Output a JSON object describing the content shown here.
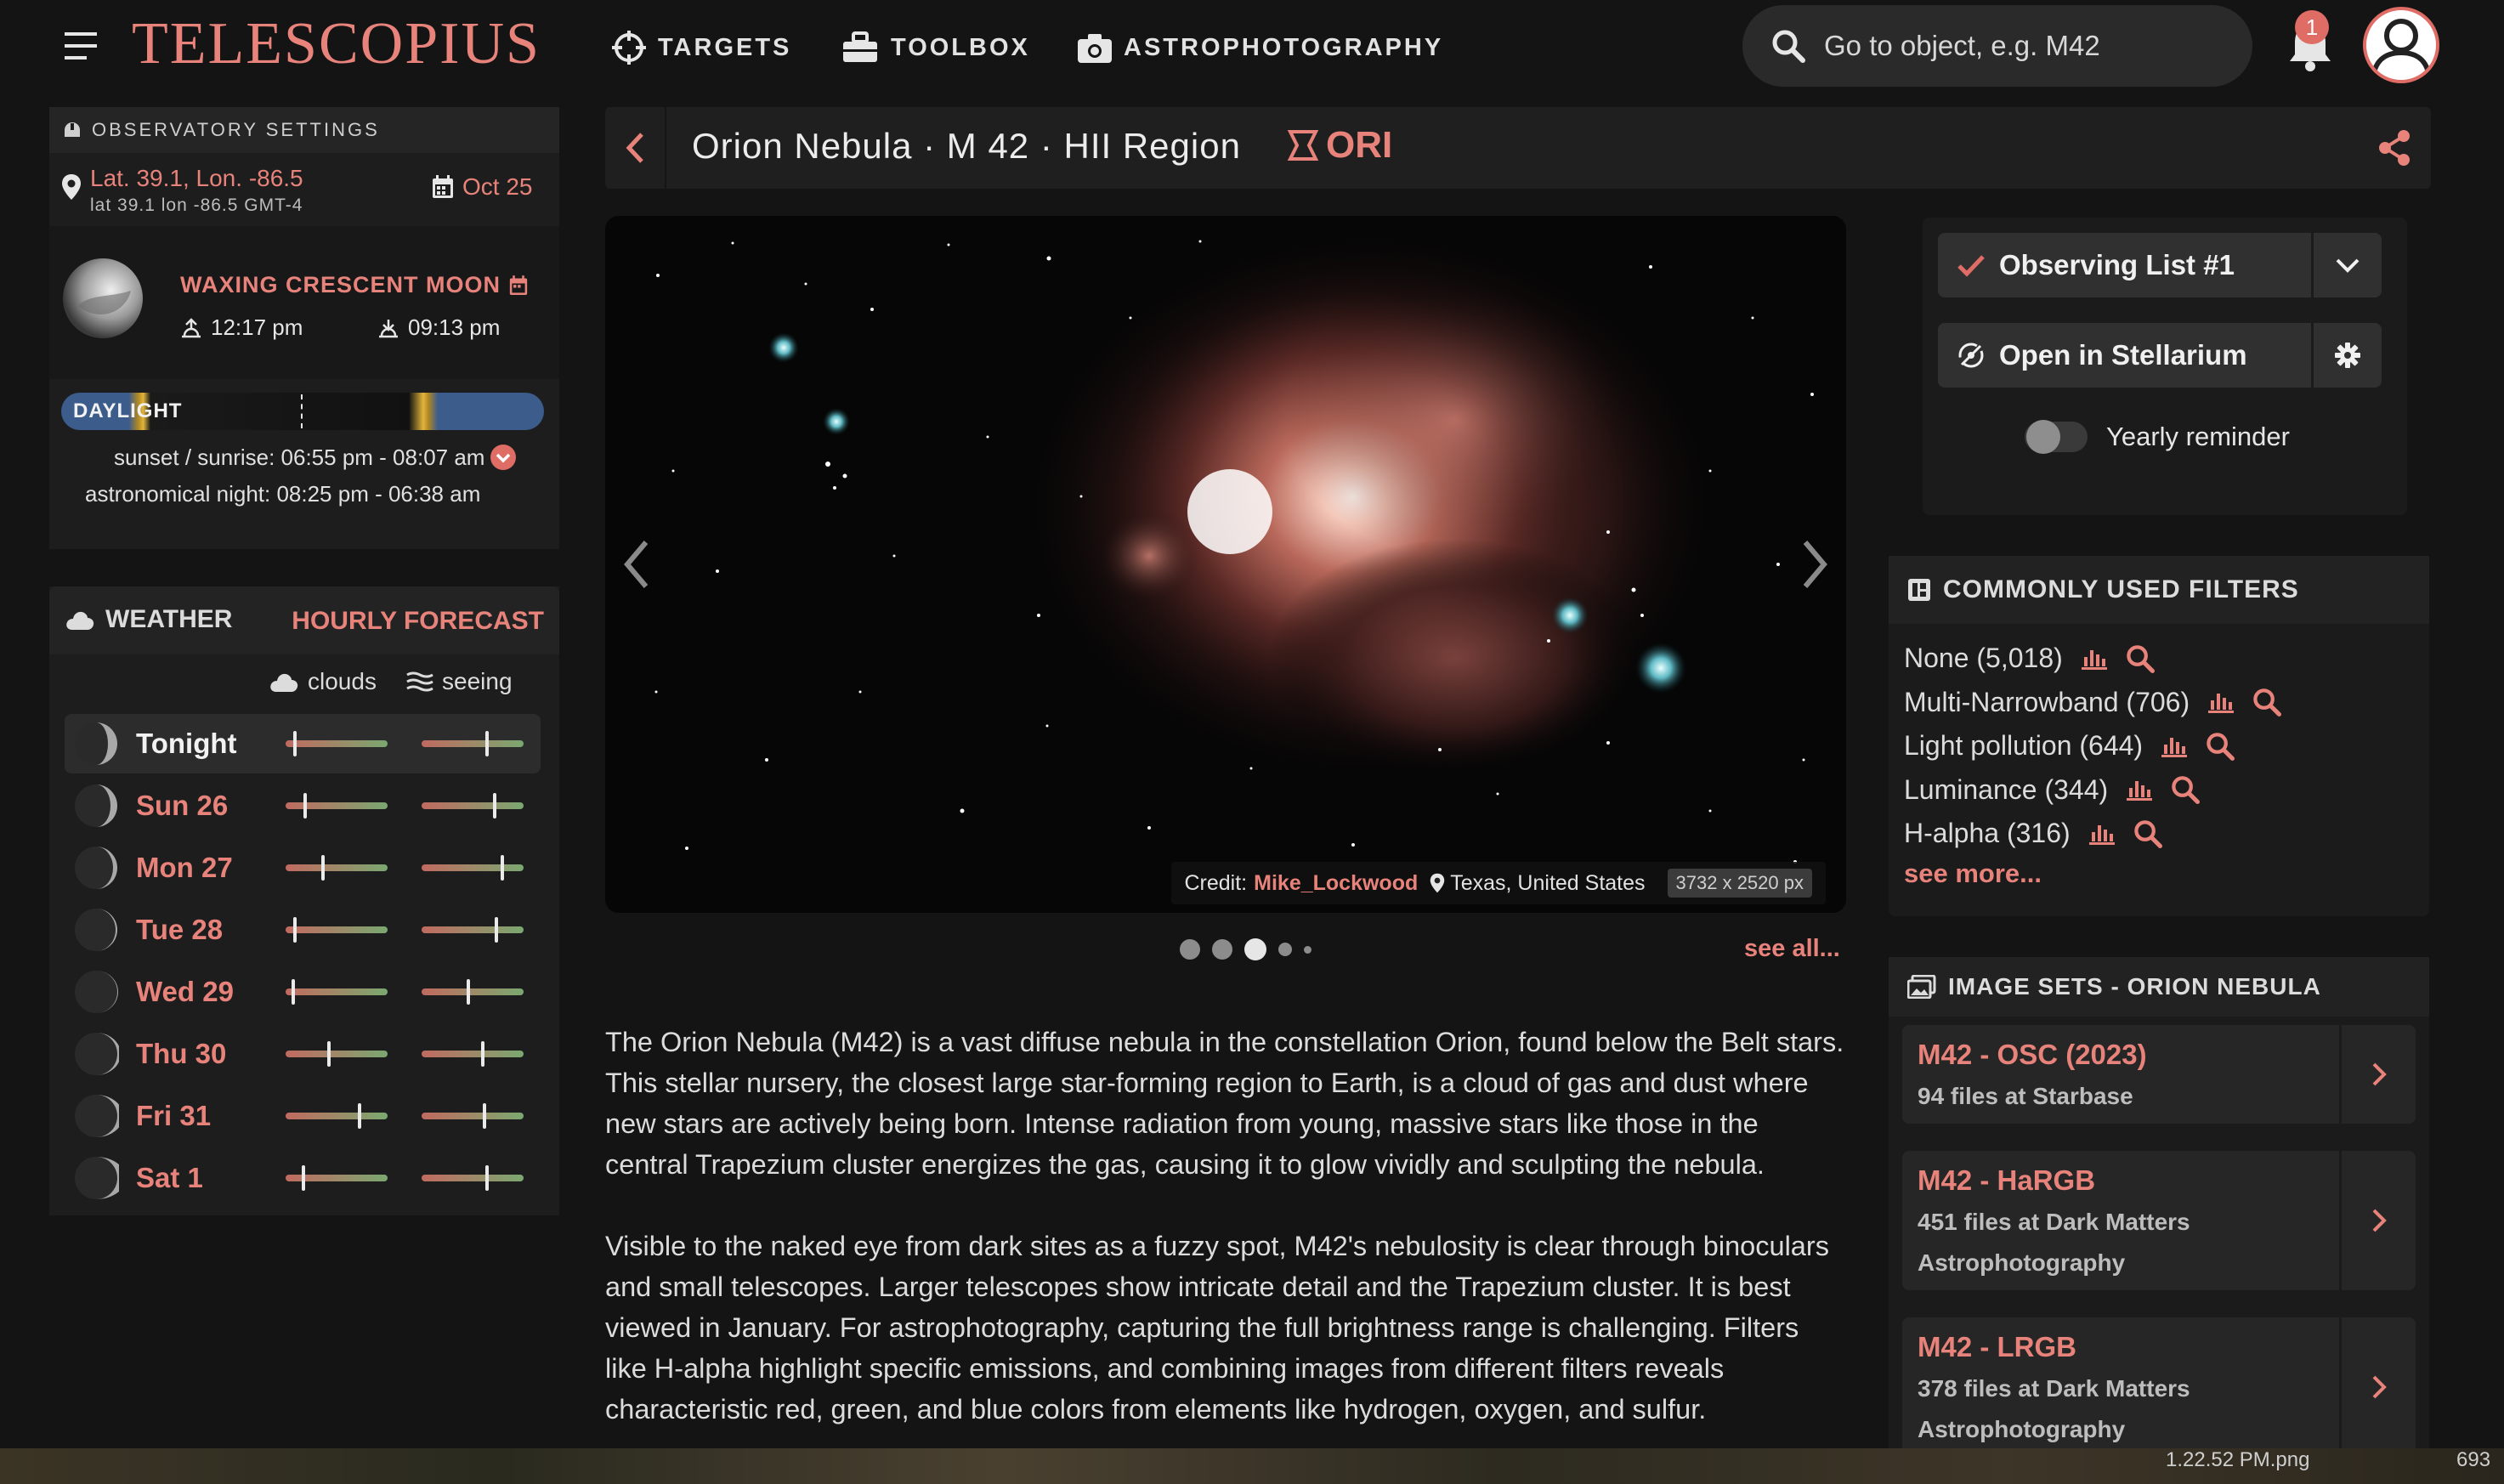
{
  "app": {
    "brand": "TELESCOPIUS",
    "nav": [
      {
        "label": "TARGETS"
      },
      {
        "label": "TOOLBOX"
      },
      {
        "label": "ASTROPHOTOGRAPHY"
      }
    ],
    "search_placeholder": "Go to object, e.g. M42",
    "notifications_count": "1"
  },
  "observatory": {
    "header": "OBSERVATORY SETTINGS",
    "location": "Lat. 39.1, Lon. -86.5",
    "location_sub": "lat 39.1  lon -86.5  GMT-4",
    "date": "Oct 25",
    "moon_phase": "WAXING CRESCENT MOON",
    "moonrise": "12:17 pm",
    "moonset": "09:13 pm",
    "daylight_label": "DAYLIGHT",
    "sunset_sunrise": "sunset / sunrise: 06:55 pm - 08:07 am",
    "astro_night": "astronomical night: 08:25 pm - 06:38 am"
  },
  "weather": {
    "header": "WEATHER",
    "forecast_link": "HOURLY FORECAST",
    "clouds_label": "clouds",
    "seeing_label": "seeing",
    "days": [
      {
        "name": "Tonight",
        "clouds": 0.08,
        "seeing": 0.65
      },
      {
        "name": "Sun 26",
        "clouds": 0.18,
        "seeing": 0.72
      },
      {
        "name": "Mon 27",
        "clouds": 0.36,
        "seeing": 0.8
      },
      {
        "name": "Tue 28",
        "clouds": 0.08,
        "seeing": 0.74
      },
      {
        "name": "Wed 29",
        "clouds": 0.06,
        "seeing": 0.46
      },
      {
        "name": "Thu 30",
        "clouds": 0.42,
        "seeing": 0.6
      },
      {
        "name": "Fri 31",
        "clouds": 0.73,
        "seeing": 0.62
      },
      {
        "name": "Sat 1",
        "clouds": 0.16,
        "seeing": 0.65
      }
    ]
  },
  "object": {
    "title": "Orion Nebula · M 42 · HII Region",
    "constellation": "ORI",
    "credit_label": "Credit:",
    "credit_user": "Mike_Lockwood",
    "credit_location": "Texas, United States",
    "dimensions": "3732 x 2520 px",
    "see_all": "see all...",
    "description_1": "The Orion Nebula (M42) is a vast diffuse nebula in the constellation Orion, found below the Belt stars. This stellar nursery, the closest large star-forming region to Earth, is a cloud of gas and dust where new stars are actively being born. Intense radiation from young, massive stars like those in the central Trapezium cluster energizes the gas, causing it to glow vividly and sculpting the nebula.",
    "description_2": "Visible to the naked eye from dark sites as a fuzzy spot, M42's nebulosity is clear through binoculars and small telescopes. Larger telescopes show intricate detail and the Trapezium cluster. It is best viewed in January. For astrophotography, capturing the full brightness range is challenging. Filters like H-alpha highlight specific emissions, and combining images from different filters reveals characteristic red, green, and blue colors from elements like hydrogen, oxygen, and sulfur."
  },
  "actions": {
    "observing_list": "Observing List #1",
    "stellarium": "Open in Stellarium",
    "yearly_reminder": "Yearly reminder"
  },
  "filters": {
    "header": "COMMONLY USED FILTERS",
    "items": [
      {
        "label": "None (5,018)"
      },
      {
        "label": "Multi-Narrowband (706)"
      },
      {
        "label": "Light pollution (644)"
      },
      {
        "label": "Luminance (344)"
      },
      {
        "label": "H-alpha (316)"
      }
    ],
    "see_more": "see more..."
  },
  "image_sets": {
    "header": "IMAGE SETS - ORION NEBULA",
    "items": [
      {
        "title": "M42 - OSC (2023)",
        "sub": "94 files at Starbase"
      },
      {
        "title": "M42 - HaRGB",
        "sub": "451 files at Dark Matters Astrophotography"
      },
      {
        "title": "M42 - LRGB",
        "sub": "378 files at Dark Matters Astrophotography"
      }
    ]
  },
  "dock": {
    "file_label": "1.22.52 PM.png",
    "right_label": "693"
  },
  "colors": {
    "accent": "#e8837b",
    "background": "#141414",
    "panel": "#1d1d1d"
  }
}
